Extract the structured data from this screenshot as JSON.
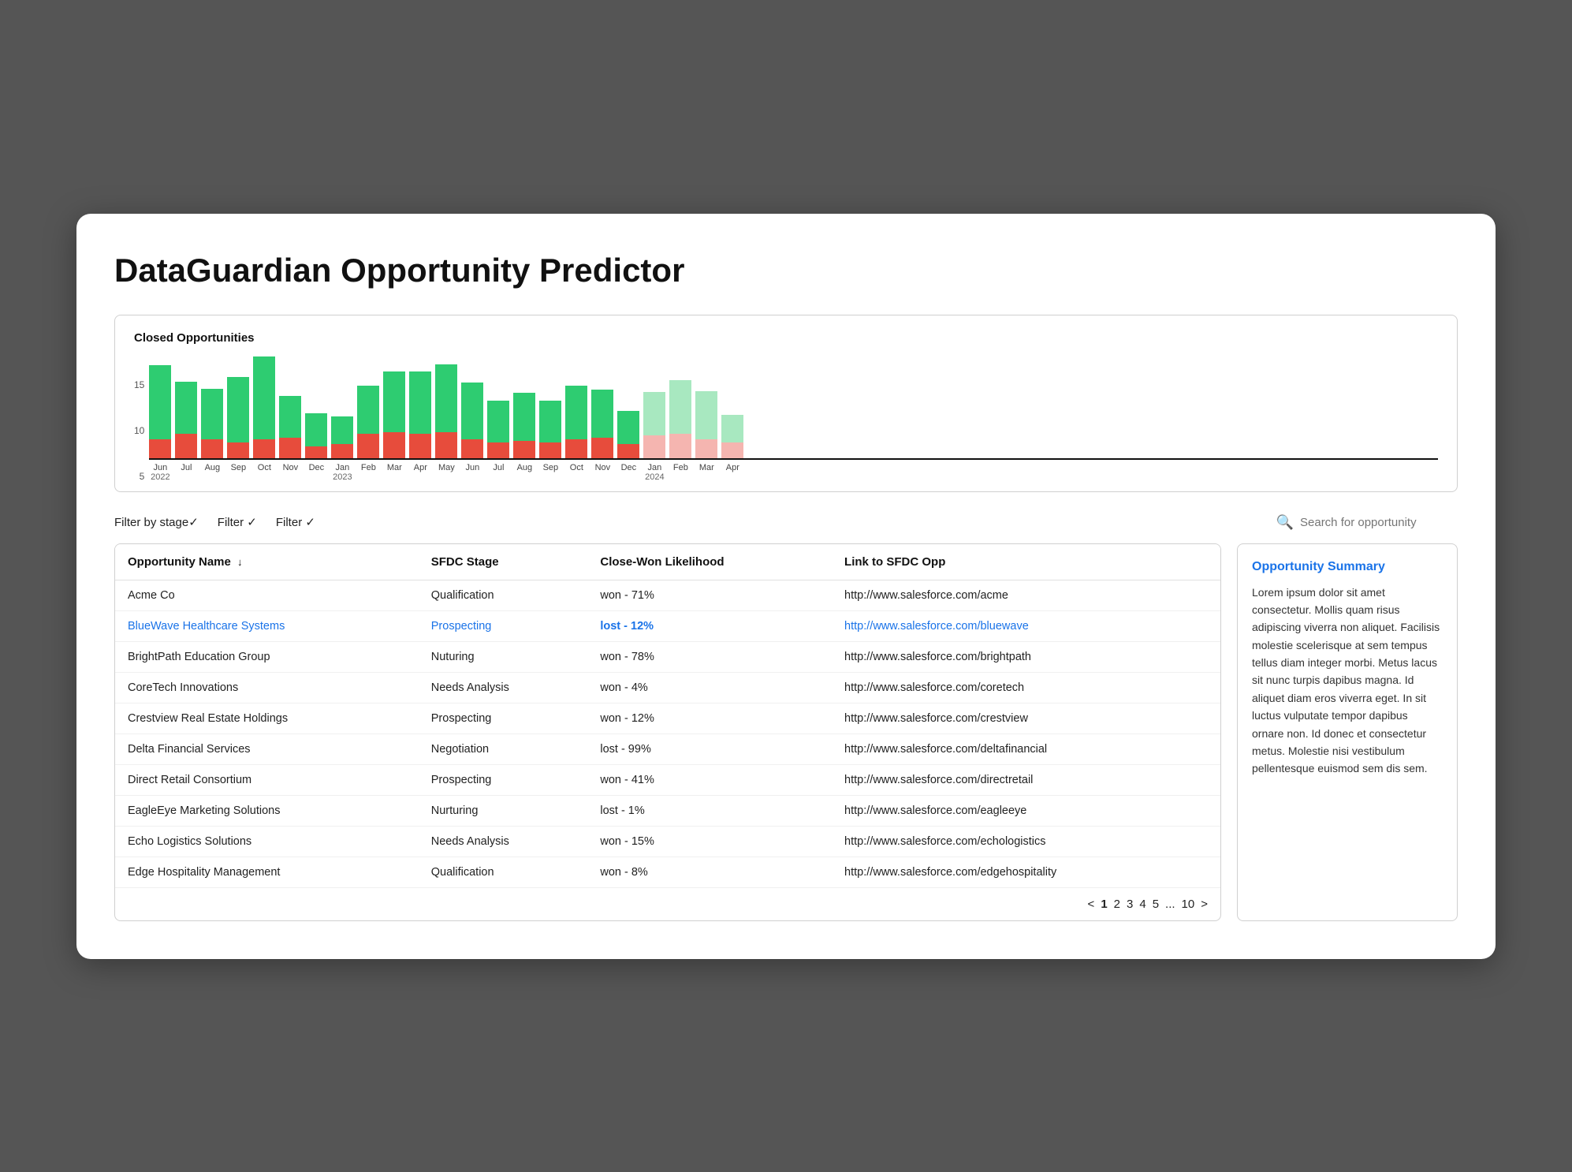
{
  "page": {
    "title": "DataGuardian Opportunity Predictor"
  },
  "chart": {
    "title": "Closed Opportunities",
    "y_labels": [
      "5",
      "10",
      "15"
    ],
    "bars": [
      {
        "month": "Jun",
        "year": "2022",
        "green": 85,
        "red": 22,
        "faded": false
      },
      {
        "month": "Jul",
        "year": "",
        "green": 60,
        "red": 28,
        "faded": false
      },
      {
        "month": "Aug",
        "year": "",
        "green": 58,
        "red": 22,
        "faded": false
      },
      {
        "month": "Sep",
        "year": "",
        "green": 75,
        "red": 18,
        "faded": false
      },
      {
        "month": "Oct",
        "year": "",
        "green": 95,
        "red": 22,
        "faded": false
      },
      {
        "month": "Nov",
        "year": "",
        "green": 48,
        "red": 24,
        "faded": false
      },
      {
        "month": "Dec",
        "year": "",
        "green": 38,
        "red": 14,
        "faded": false
      },
      {
        "month": "Jan",
        "year": "2023",
        "green": 32,
        "red": 16,
        "faded": false
      },
      {
        "month": "Feb",
        "year": "",
        "green": 55,
        "red": 28,
        "faded": false
      },
      {
        "month": "Mar",
        "year": "",
        "green": 70,
        "red": 30,
        "faded": false
      },
      {
        "month": "Apr",
        "year": "",
        "green": 72,
        "red": 28,
        "faded": false
      },
      {
        "month": "May",
        "year": "",
        "green": 78,
        "red": 30,
        "faded": false
      },
      {
        "month": "Jun",
        "year": "",
        "green": 65,
        "red": 22,
        "faded": false
      },
      {
        "month": "Jul",
        "year": "",
        "green": 48,
        "red": 18,
        "faded": false
      },
      {
        "month": "Aug",
        "year": "",
        "green": 55,
        "red": 20,
        "faded": false
      },
      {
        "month": "Sep",
        "year": "",
        "green": 48,
        "red": 18,
        "faded": false
      },
      {
        "month": "Oct",
        "year": "",
        "green": 62,
        "red": 22,
        "faded": false
      },
      {
        "month": "Nov",
        "year": "",
        "green": 55,
        "red": 24,
        "faded": false
      },
      {
        "month": "Dec",
        "year": "",
        "green": 38,
        "red": 16,
        "faded": false
      },
      {
        "month": "Jan",
        "year": "2024",
        "green": 50,
        "red": 26,
        "faded": true
      },
      {
        "month": "Feb",
        "year": "",
        "green": 62,
        "red": 28,
        "faded": true
      },
      {
        "month": "Mar",
        "year": "",
        "green": 55,
        "red": 22,
        "faded": true
      },
      {
        "month": "Apr",
        "year": "",
        "green": 32,
        "red": 18,
        "faded": true
      }
    ]
  },
  "filters": {
    "filter1": "Filter by stage✓",
    "filter2": "Filter ✓",
    "filter3": "Filter ✓",
    "search_placeholder": "Search for opportunity"
  },
  "table": {
    "columns": [
      "Opportunity Name",
      "SFDC Stage",
      "Close-Won Likelihood",
      "Link to SFDC Opp"
    ],
    "rows": [
      {
        "name": "Acme Co",
        "stage": "Qualification",
        "likelihood": "won - 71%",
        "link": "http://www.salesforce.com/acme",
        "highlight": false
      },
      {
        "name": "BlueWave Healthcare Systems",
        "stage": "Prospecting",
        "likelihood": "lost - 12%",
        "link": "http://www.salesforce.com/bluewave",
        "highlight": true
      },
      {
        "name": "BrightPath Education Group",
        "stage": "Nuturing",
        "likelihood": "won - 78%",
        "link": "http://www.salesforce.com/brightpath",
        "highlight": false
      },
      {
        "name": "CoreTech Innovations",
        "stage": "Needs Analysis",
        "likelihood": "won - 4%",
        "link": "http://www.salesforce.com/coretech",
        "highlight": false
      },
      {
        "name": "Crestview Real Estate Holdings",
        "stage": "Prospecting",
        "likelihood": "won - 12%",
        "link": "http://www.salesforce.com/crestview",
        "highlight": false
      },
      {
        "name": "Delta Financial Services",
        "stage": "Negotiation",
        "likelihood": "lost - 99%",
        "link": "http://www.salesforce.com/deltafinancial",
        "highlight": false
      },
      {
        "name": "Direct Retail Consortium",
        "stage": "Prospecting",
        "likelihood": "won - 41%",
        "link": "http://www.salesforce.com/directretail",
        "highlight": false
      },
      {
        "name": "EagleEye Marketing Solutions",
        "stage": "Nurturing",
        "likelihood": "lost - 1%",
        "link": "http://www.salesforce.com/eagleeye",
        "highlight": false
      },
      {
        "name": "Echo Logistics Solutions",
        "stage": "Needs Analysis",
        "likelihood": "won - 15%",
        "link": "http://www.salesforce.com/echologistics",
        "highlight": false
      },
      {
        "name": "Edge Hospitality Management",
        "stage": "Qualification",
        "likelihood": "won - 8%",
        "link": "http://www.salesforce.com/edgehospitality",
        "highlight": false
      }
    ],
    "pagination": {
      "prev": "<",
      "pages": [
        "1",
        "2",
        "3",
        "4",
        "5",
        "...",
        "10"
      ],
      "next": ">",
      "current": "1"
    }
  },
  "summary": {
    "title": "Opportunity Summary",
    "text": "Lorem ipsum dolor sit amet consectetur. Mollis quam risus adipiscing viverra non aliquet. Facilisis molestie scelerisque at sem tempus tellus diam integer morbi. Metus lacus sit nunc turpis dapibus magna. Id aliquet diam eros viverra eget. In sit luctus vulputate tempor dapibus ornare non. Id donec et consectetur metus. Molestie nisi vestibulum pellentesque euismod sem dis sem."
  }
}
